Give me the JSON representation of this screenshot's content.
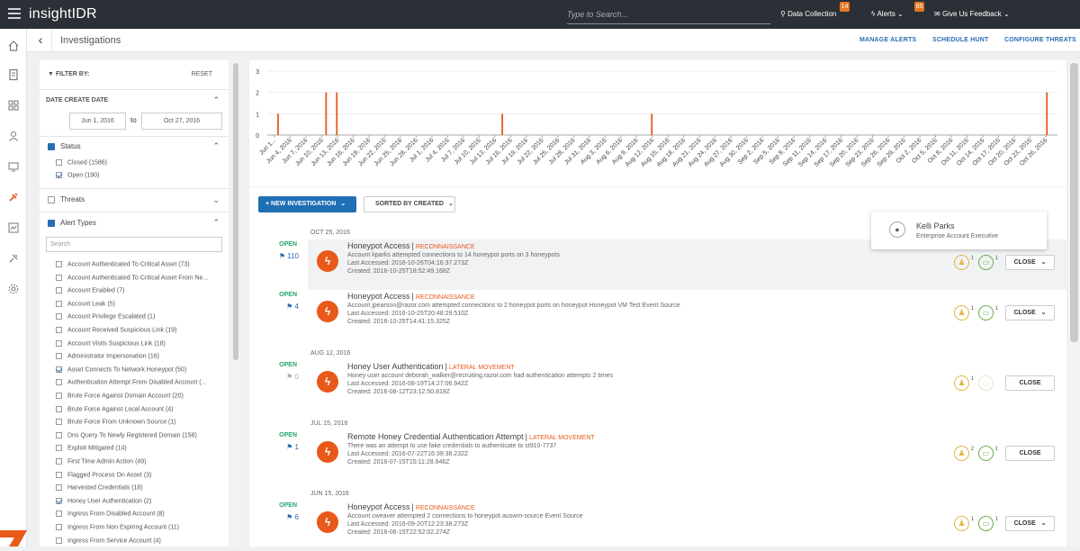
{
  "app": {
    "title": "insightIDR"
  },
  "topbar": {
    "search_placeholder": "Type to Search...",
    "data_collection": {
      "label": "Data Collection",
      "badge": "14"
    },
    "alerts": {
      "label": "Alerts",
      "badge": "65"
    },
    "feedback": {
      "label": "Give Us Feedback"
    }
  },
  "subheader": {
    "breadcrumb": "Investigations",
    "links": [
      "MANAGE ALERTS",
      "SCHEDULE HUNT",
      "CONFIGURE THREATS"
    ]
  },
  "filter": {
    "title": "FILTER BY:",
    "reset": "RESET",
    "date_section": "DATE CREATE DATE",
    "date_from": "Jun 1, 2016",
    "date_to_label": "to",
    "date_to": "Oct 27, 2016",
    "status": {
      "title": "Status",
      "items": [
        {
          "label": "Closed (1586)",
          "checked": false
        },
        {
          "label": "Open (190)",
          "checked": true
        }
      ]
    },
    "threats": {
      "title": "Threats"
    },
    "alert_types": {
      "title": "Alert Types",
      "search_placeholder": "Search",
      "items": [
        {
          "label": "Account Authenticated To Critical Asset (73)",
          "checked": false
        },
        {
          "label": "Account Authenticated To Critical Asset From Ne...",
          "checked": false
        },
        {
          "label": "Account Enabled (7)",
          "checked": false
        },
        {
          "label": "Account Leak (5)",
          "checked": false
        },
        {
          "label": "Account Privilege Escalated (1)",
          "checked": false
        },
        {
          "label": "Account Received Suspicious Link (19)",
          "checked": false
        },
        {
          "label": "Account Visits Suspicious Link (18)",
          "checked": false
        },
        {
          "label": "Administrator Impersonation (16)",
          "checked": false
        },
        {
          "label": "Asset Connects To Network Honeypot (50)",
          "checked": true
        },
        {
          "label": "Authentication Attempt From Disabled Account (...",
          "checked": false
        },
        {
          "label": "Brute Force Against Domain Account (20)",
          "checked": false
        },
        {
          "label": "Brute Force Against Local Account (4)",
          "checked": false
        },
        {
          "label": "Brute Force From Unknown Source (1)",
          "checked": false
        },
        {
          "label": "Dns Query To Newly Registered Domain (158)",
          "checked": false
        },
        {
          "label": "Exploit Mitigated (14)",
          "checked": false
        },
        {
          "label": "First Time Admin Action (49)",
          "checked": false
        },
        {
          "label": "Flagged Process On Asset (3)",
          "checked": false
        },
        {
          "label": "Harvested Credentials (18)",
          "checked": false
        },
        {
          "label": "Honey User Authentication (2)",
          "checked": true
        },
        {
          "label": "Ingress From Disabled Account (8)",
          "checked": false
        },
        {
          "label": "Ingress From Non Expiring Account (11)",
          "checked": false
        },
        {
          "label": "Ingress From Service Account (4)",
          "checked": false
        }
      ]
    }
  },
  "chart_data": {
    "type": "bar",
    "ylim": [
      0,
      3
    ],
    "yticks": [
      0,
      1,
      2,
      3
    ],
    "xtick_labels": [
      "Jun 1...",
      "Jun 4, 2016",
      "Jun 7, 2016",
      "Jun 10, 2016",
      "Jun 13, 2016",
      "Jun 16, 2016",
      "Jun 19, 2016",
      "Jun 22, 2016",
      "Jun 25, 2016",
      "Jun 28, 2016",
      "Jul 1, 2016",
      "Jul 4, 2016",
      "Jul 7, 2016",
      "Jul 10, 2016",
      "Jul 13, 2016",
      "Jul 16, 2016",
      "Jul 19, 2016",
      "Jul 22, 2016",
      "Jul 25, 2016",
      "Jul 28, 2016",
      "Jul 31, 2016",
      "Aug 3, 2016",
      "Aug 6, 2016",
      "Aug 9, 2016",
      "Aug 12, 2016",
      "Aug 15, 2016",
      "Aug 18, 2016",
      "Aug 21, 2016",
      "Aug 24, 2016",
      "Aug 27, 2016",
      "Aug 30, 2016",
      "Sep 2, 2016",
      "Sep 5, 2016",
      "Sep 8, 2016",
      "Sep 11, 2016",
      "Sep 14, 2016",
      "Sep 17, 2016",
      "Sep 20, 2016",
      "Sep 23, 2016",
      "Sep 26, 2016",
      "Sep 29, 2016",
      "Oct 2, 2016",
      "Oct 5, 2016",
      "Oct 8, 2016",
      "Oct 11, 2016",
      "Oct 14, 2016",
      "Oct 17, 2016",
      "Oct 20, 2016",
      "Oct 23, 2016",
      "Oct 26, 2016"
    ],
    "day_range": [
      "2016-06-01",
      "2016-10-27"
    ],
    "bars": [
      {
        "date": "2016-06-03",
        "value": 1
      },
      {
        "date": "2016-06-12",
        "value": 2
      },
      {
        "date": "2016-06-14",
        "value": 2
      },
      {
        "date": "2016-07-15",
        "value": 1
      },
      {
        "date": "2016-08-12",
        "value": 1
      },
      {
        "date": "2016-10-25",
        "value": 2
      }
    ],
    "bar_color": "#e8591a"
  },
  "main": {
    "new_investigation": "NEW INVESTIGATION",
    "sorted_by": "SORTED BY CREATED",
    "groups": [
      {
        "date": "OCT 25, 2016",
        "items": [
          {
            "status": "OPEN",
            "count": "110",
            "title": "Honeypot Access",
            "tag": "RECONNAISSANCE",
            "desc": "Account kparks attempted connections to 14 honeypot ports on 3 honeypots",
            "last": "Last Accessed: 2016-10-26T04:16:37.273Z",
            "created": "Created: 2016-10-25T18:52:49.168Z",
            "users": "1",
            "assets": "1",
            "close": "CLOSE",
            "dropdown": true
          },
          {
            "status": "OPEN",
            "count": "4",
            "title": "Honeypot Access",
            "tag": "RECONNAISSANCE",
            "desc": "Account jpearson@razor.com attempted connections to 2 honeypot ports on honeypot Honeypot VM Test Event Source",
            "last": "Last Accessed: 2016-10-25T20:48:29.510Z",
            "created": "Created: 2016-10-25T14:41:15.325Z",
            "users": "1",
            "assets": "1",
            "close": "CLOSE",
            "dropdown": true
          }
        ]
      },
      {
        "date": "AUG 12, 2016",
        "items": [
          {
            "status": "OPEN",
            "count": "0",
            "title": "Honey User Authentication",
            "tag": "LATERAL MOVEMENT",
            "desc": "Honey user account deborah_walker@recruiting.razor.com had authentication attempts 2 times",
            "last": "Last Accessed: 2016-08-19T14:27:06.942Z",
            "created": "Created: 2016-08-12T23:12:50.819Z",
            "users": "1",
            "assets": "",
            "close": "CLOSE",
            "dropdown": false
          }
        ]
      },
      {
        "date": "JUL 15, 2016",
        "items": [
          {
            "status": "OPEN",
            "count": "1",
            "title": "Remote Honey Credential Authentication Attempt",
            "tag": "LATERAL MOVEMENT",
            "desc": "There was an attempt to use fake credentials to authenticate to st910-7737",
            "last": "Last Accessed: 2016-07-22T16:39:38.232Z",
            "created": "Created: 2016-07-15T15:11:28.946Z",
            "users": "2",
            "assets": "1",
            "close": "CLOSE",
            "dropdown": false
          }
        ]
      },
      {
        "date": "JUN 15, 2016",
        "items": [
          {
            "status": "OPEN",
            "count": "6",
            "title": "Honeypot Access",
            "tag": "RECONNAISSANCE",
            "desc": "Account cweaver attempted 2 connections to honeypot auswm-source Event Source",
            "last": "Last Accessed: 2016-09-20T12:23:38.273Z",
            "created": "Created: 2016-06-15T22:52:02.274Z",
            "users": "1",
            "assets": "1",
            "close": "CLOSE",
            "dropdown": true
          }
        ]
      }
    ]
  },
  "hover_card": {
    "name": "Kelli Parks",
    "role": "Enterprise Account Executive"
  }
}
